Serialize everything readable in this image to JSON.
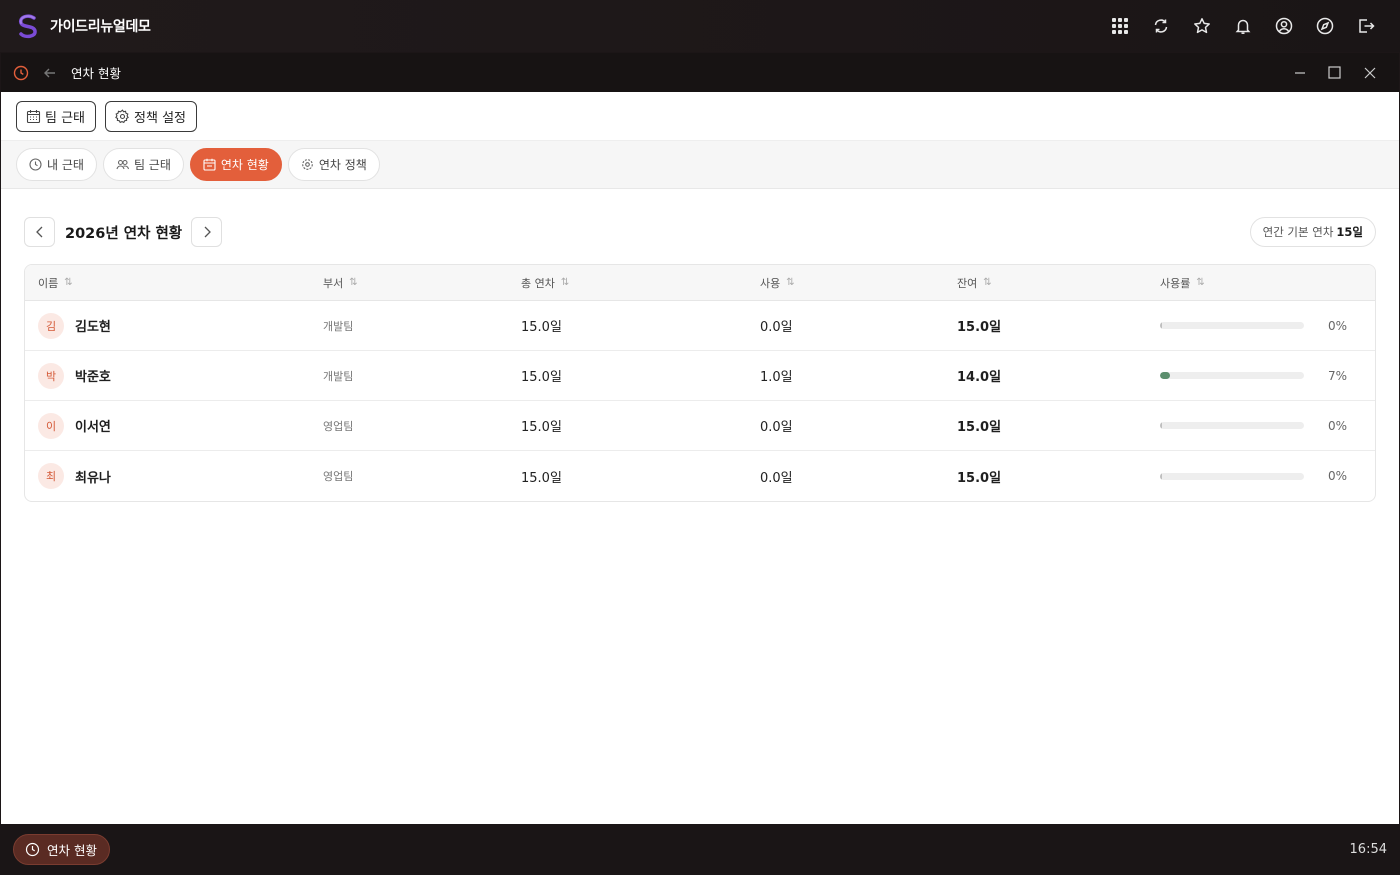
{
  "app": {
    "title": "가이드리뉴얼데모"
  },
  "top_icons": [
    "apps-grid-icon",
    "refresh-icon",
    "star-icon",
    "bell-icon",
    "user-icon",
    "compass-icon",
    "logout-icon"
  ],
  "window": {
    "title": "연차 현황"
  },
  "toolbar": {
    "team_attendance": "팀 근태",
    "policy_settings": "정책 설정"
  },
  "tabs": [
    {
      "label": "내 근태",
      "icon": "clock-icon",
      "active": false
    },
    {
      "label": "팀 근태",
      "icon": "users-icon",
      "active": false
    },
    {
      "label": "연차 현황",
      "icon": "calendar-icon",
      "active": true
    },
    {
      "label": "연차 정책",
      "icon": "gear-icon",
      "active": false
    }
  ],
  "page": {
    "year_title": "2026년 연차 현황",
    "default_label": "연간 기본 연차",
    "default_value": "15일"
  },
  "table": {
    "headers": {
      "name": "이름",
      "dept": "부서",
      "total": "총 연차",
      "used": "사용",
      "remaining": "잔여",
      "rate": "사용률"
    },
    "rows": [
      {
        "initial": "김",
        "name": "김도현",
        "dept": "개발팀",
        "total": "15.0일",
        "used": "0.0일",
        "remaining": "15.0일",
        "rate_label": "0%",
        "rate": 0
      },
      {
        "initial": "박",
        "name": "박준호",
        "dept": "개발팀",
        "total": "15.0일",
        "used": "1.0일",
        "remaining": "14.0일",
        "rate_label": "7%",
        "rate": 0.07
      },
      {
        "initial": "이",
        "name": "이서연",
        "dept": "영업팀",
        "total": "15.0일",
        "used": "0.0일",
        "remaining": "15.0일",
        "rate_label": "0%",
        "rate": 0
      },
      {
        "initial": "최",
        "name": "최유나",
        "dept": "영업팀",
        "total": "15.0일",
        "used": "0.0일",
        "remaining": "15.0일",
        "rate_label": "0%",
        "rate": 0
      }
    ]
  },
  "taskbar": {
    "app_label": "연차 현황",
    "time": "16:54"
  },
  "colors": {
    "accent": "#e35f3b",
    "progress": "#5c8f6e",
    "avatar_bg": "#fbe9e4"
  }
}
